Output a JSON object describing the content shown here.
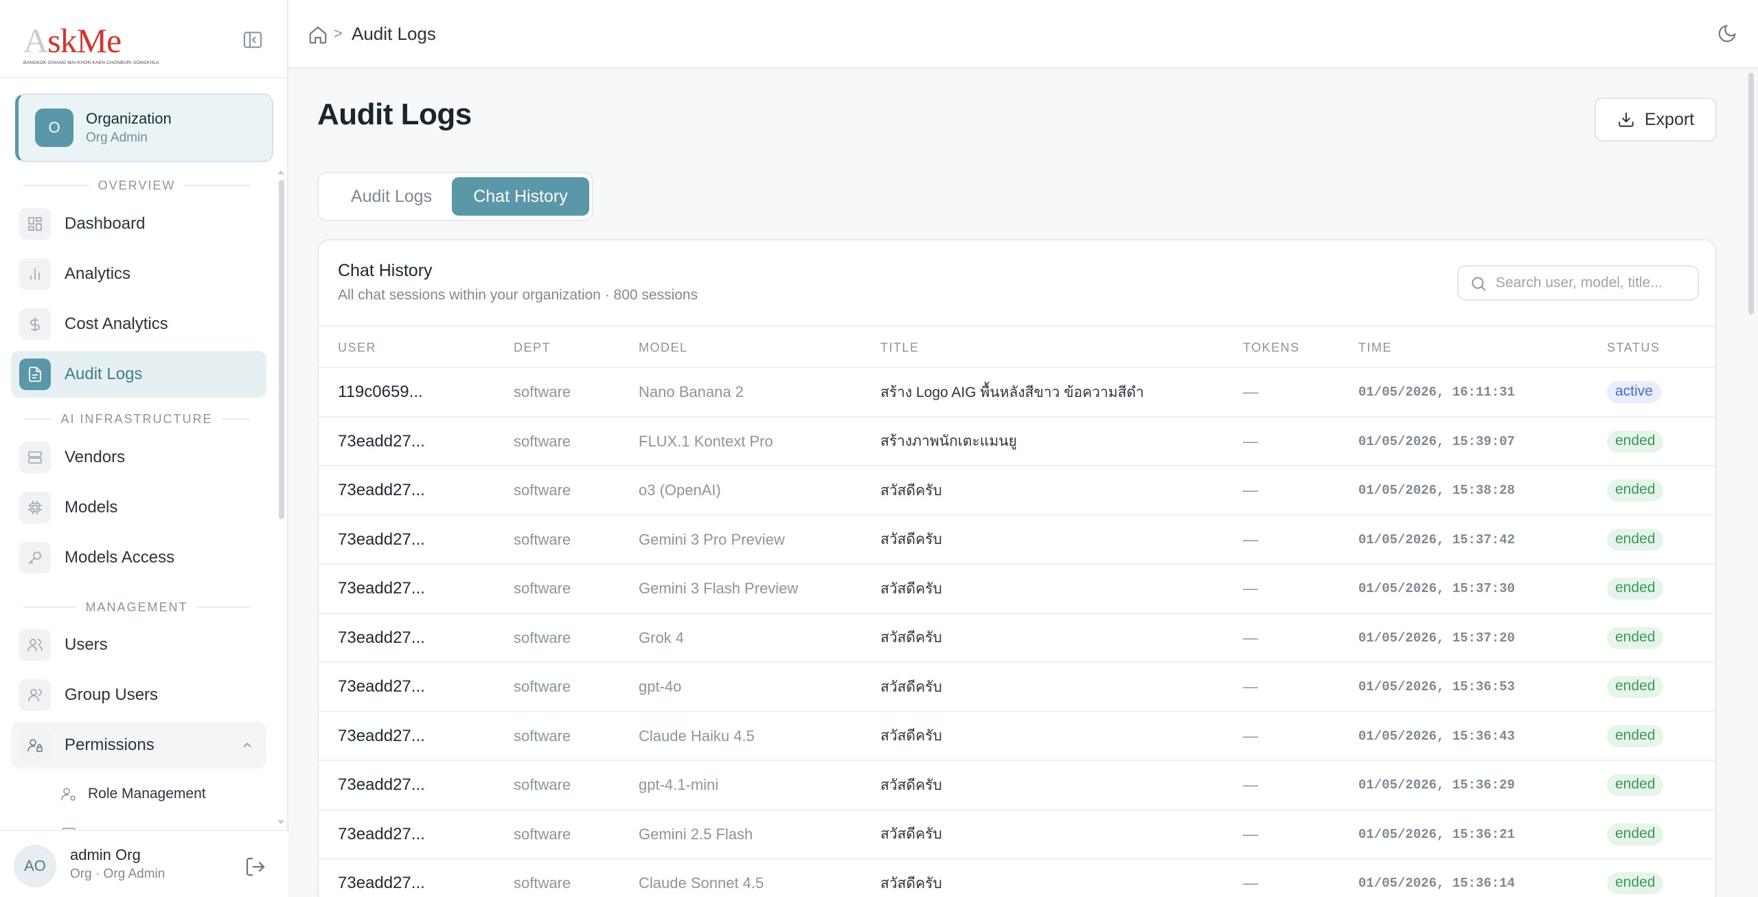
{
  "brand": {
    "logo_text_1": "A",
    "logo_text_2": "skMe",
    "logo_tagline": "BANGKOK·CHIANG MAI·KHON KAEN·CHONBURI·SONGKHLA"
  },
  "org": {
    "avatar": "O",
    "name": "Organization",
    "role": "Org Admin"
  },
  "sections": {
    "overview": "OVERVIEW",
    "ai_infra": "AI INFRASTRUCTURE",
    "management": "MANAGEMENT"
  },
  "nav": {
    "dashboard": "Dashboard",
    "analytics": "Analytics",
    "cost_analytics": "Cost Analytics",
    "audit_logs": "Audit Logs",
    "vendors": "Vendors",
    "models": "Models",
    "models_access": "Models Access",
    "users": "Users",
    "group_users": "Group Users",
    "permissions": "Permissions",
    "role_management": "Role Management"
  },
  "icons": {
    "collapse": "sidebar-collapse-icon",
    "home": "home-icon",
    "theme": "moon-icon",
    "export": "download-icon",
    "search": "search-icon",
    "logout": "logout-icon"
  },
  "user": {
    "avatar": "AO",
    "name": "admin Org",
    "role": "Org · Org Admin"
  },
  "breadcrumb": {
    "separator": ">",
    "current": "Audit Logs"
  },
  "page": {
    "title": "Audit Logs",
    "export_label": "Export"
  },
  "tabs": {
    "audit_logs": "Audit Logs",
    "chat_history": "Chat History"
  },
  "card": {
    "title": "Chat History",
    "subtitle": "All chat sessions within your organization · 800 sessions",
    "search_placeholder": "Search user, model, title..."
  },
  "table": {
    "headers": {
      "user": "USER",
      "dept": "DEPT",
      "model": "MODEL",
      "title": "TITLE",
      "tokens": "TOKENS",
      "time": "TIME",
      "status": "STATUS"
    },
    "rows": [
      {
        "user": "119c0659...",
        "dept": "software",
        "model": "Nano Banana 2",
        "title": "สร้าง Logo AIG พื้นหลังสีขาว ข้อความสีดำ",
        "tokens": "—",
        "time": "01/05/2026, 16:11:31",
        "status": "active"
      },
      {
        "user": "73eadd27...",
        "dept": "software",
        "model": "FLUX.1 Kontext Pro",
        "title": "สร้างภาพนักเตะแมนยู",
        "tokens": "—",
        "time": "01/05/2026, 15:39:07",
        "status": "ended"
      },
      {
        "user": "73eadd27...",
        "dept": "software",
        "model": "o3 (OpenAI)",
        "title": "สวัสดีครับ",
        "tokens": "—",
        "time": "01/05/2026, 15:38:28",
        "status": "ended"
      },
      {
        "user": "73eadd27...",
        "dept": "software",
        "model": "Gemini 3 Pro Preview",
        "title": "สวัสดีครับ",
        "tokens": "—",
        "time": "01/05/2026, 15:37:42",
        "status": "ended"
      },
      {
        "user": "73eadd27...",
        "dept": "software",
        "model": "Gemini 3 Flash Preview",
        "title": "สวัสดีครับ",
        "tokens": "—",
        "time": "01/05/2026, 15:37:30",
        "status": "ended"
      },
      {
        "user": "73eadd27...",
        "dept": "software",
        "model": "Grok 4",
        "title": "สวัสดีครับ",
        "tokens": "—",
        "time": "01/05/2026, 15:37:20",
        "status": "ended"
      },
      {
        "user": "73eadd27...",
        "dept": "software",
        "model": "gpt-4o",
        "title": "สวัสดีครับ",
        "tokens": "—",
        "time": "01/05/2026, 15:36:53",
        "status": "ended"
      },
      {
        "user": "73eadd27...",
        "dept": "software",
        "model": "Claude Haiku 4.5",
        "title": "สวัสดีครับ",
        "tokens": "—",
        "time": "01/05/2026, 15:36:43",
        "status": "ended"
      },
      {
        "user": "73eadd27...",
        "dept": "software",
        "model": "gpt-4.1-mini",
        "title": "สวัสดีครับ",
        "tokens": "—",
        "time": "01/05/2026, 15:36:29",
        "status": "ended"
      },
      {
        "user": "73eadd27...",
        "dept": "software",
        "model": "Gemini 2.5 Flash",
        "title": "สวัสดีครับ",
        "tokens": "—",
        "time": "01/05/2026, 15:36:21",
        "status": "ended"
      },
      {
        "user": "73eadd27...",
        "dept": "software",
        "model": "Claude Sonnet 4.5",
        "title": "สวัสดีครับ",
        "tokens": "—",
        "time": "01/05/2026, 15:36:14",
        "status": "ended"
      }
    ]
  },
  "colors": {
    "accent": "#5a97a8",
    "active_badge": "#4d66d4",
    "ended_badge": "#3d9857"
  }
}
